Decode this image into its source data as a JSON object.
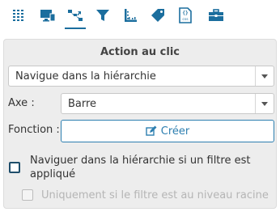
{
  "toolbar": {
    "icons": [
      {
        "name": "grid-dots-icon",
        "label": ""
      },
      {
        "name": "monitor-icon",
        "label": ""
      },
      {
        "name": "drill-hierarchy-icon",
        "label": ""
      },
      {
        "name": "filter-funnel-icon",
        "label": ""
      },
      {
        "name": "axis-ruler-icon",
        "label": ""
      },
      {
        "name": "tag-icon",
        "label": ""
      },
      {
        "name": "css-file-icon",
        "label": "css"
      },
      {
        "name": "toolbox-icon",
        "label": ""
      }
    ],
    "active_index": 2,
    "accent_color": "#1b6e9e"
  },
  "panel": {
    "title": "Action au clic",
    "action_select": {
      "value": "Navigue dans la hiérarchie"
    },
    "axis": {
      "label": "Axe :",
      "value": "Barre"
    },
    "function": {
      "label": "Fonction :",
      "button_label": "Créer",
      "button_icon": "edit-icon"
    },
    "checkbox_drill": {
      "label": "Naviguer dans la hiérarchie si un filtre est appliqué",
      "checked": false
    },
    "checkbox_root": {
      "label": "Uniquement si le filtre est au niveau racine",
      "checked": false,
      "disabled": true
    }
  }
}
